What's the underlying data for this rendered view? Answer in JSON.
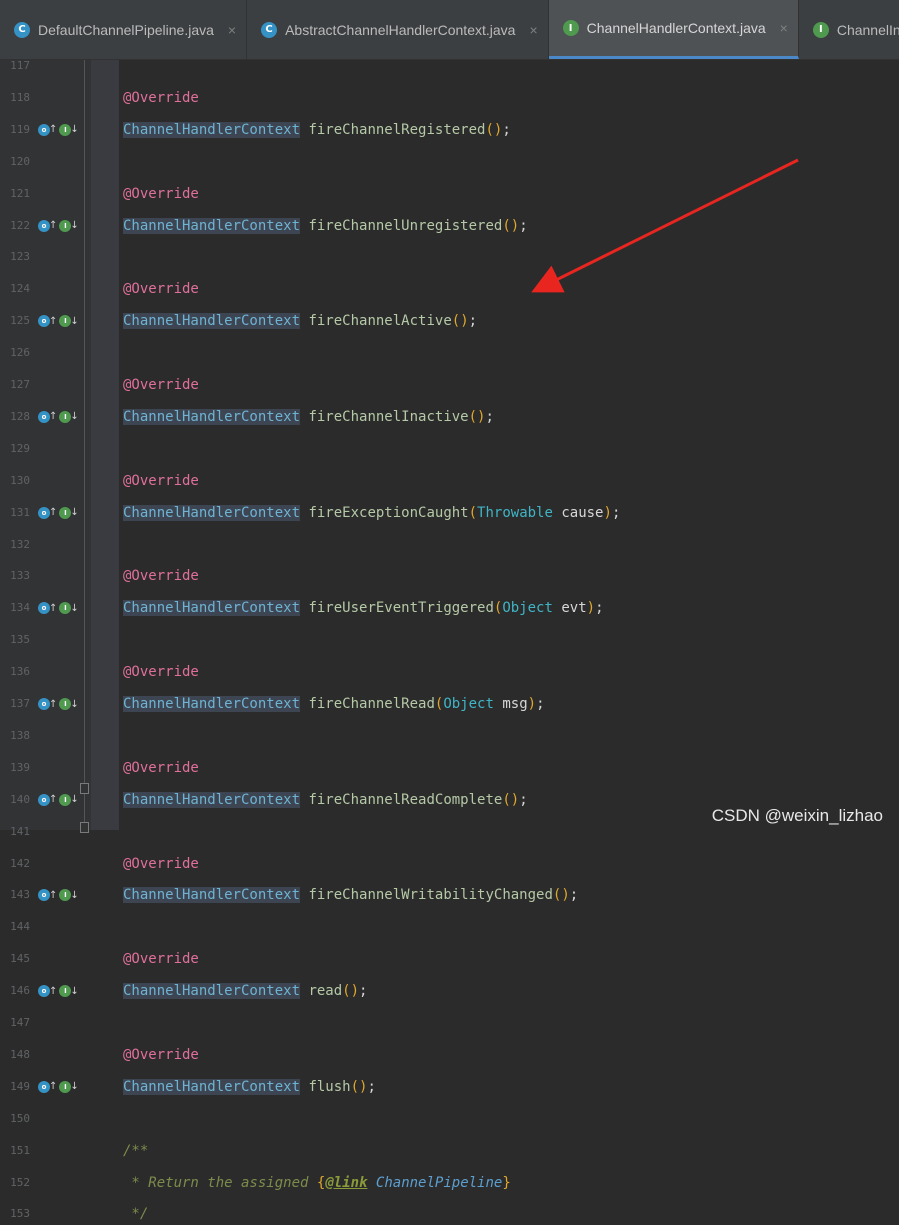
{
  "tabs": [
    {
      "label": "DefaultChannelPipeline.java",
      "icon": "class-icon",
      "icon_letter": "C",
      "close": "×"
    },
    {
      "label": "AbstractChannelHandlerContext.java",
      "icon": "class-icon",
      "icon_letter": "C",
      "close": "×"
    },
    {
      "label": "ChannelHandlerContext.java",
      "icon": "interface-icon",
      "icon_letter": "I",
      "close": "×"
    },
    {
      "label": "ChannelInbound",
      "icon": "interface-icon",
      "icon_letter": "I",
      "close": ""
    }
  ],
  "active_tab": 2,
  "editor": {
    "lines": [
      {
        "num": "117",
        "kind": "blank"
      },
      {
        "num": "118",
        "kind": "ann",
        "text": "@Override"
      },
      {
        "num": "119",
        "kind": "decl",
        "type": "ChannelHandlerContext",
        "method": "fireChannelRegistered",
        "args": "",
        "marks": true
      },
      {
        "num": "120",
        "kind": "blank"
      },
      {
        "num": "121",
        "kind": "ann",
        "text": "@Override"
      },
      {
        "num": "122",
        "kind": "decl",
        "type": "ChannelHandlerContext",
        "method": "fireChannelUnregistered",
        "args": "",
        "marks": true
      },
      {
        "num": "123",
        "kind": "blank"
      },
      {
        "num": "124",
        "kind": "ann",
        "text": "@Override"
      },
      {
        "num": "125",
        "kind": "decl",
        "type": "ChannelHandlerContext",
        "method": "fireChannelActive",
        "args": "",
        "marks": true
      },
      {
        "num": "126",
        "kind": "blank"
      },
      {
        "num": "127",
        "kind": "ann",
        "text": "@Override"
      },
      {
        "num": "128",
        "kind": "decl",
        "type": "ChannelHandlerContext",
        "method": "fireChannelInactive",
        "args": "",
        "marks": true
      },
      {
        "num": "129",
        "kind": "blank"
      },
      {
        "num": "130",
        "kind": "ann",
        "text": "@Override"
      },
      {
        "num": "131",
        "kind": "decl",
        "type": "ChannelHandlerContext",
        "method": "fireExceptionCaught",
        "argtype": "Throwable",
        "argname": "cause",
        "marks": true
      },
      {
        "num": "132",
        "kind": "blank"
      },
      {
        "num": "133",
        "kind": "ann",
        "text": "@Override"
      },
      {
        "num": "134",
        "kind": "decl",
        "type": "ChannelHandlerContext",
        "method": "fireUserEventTriggered",
        "argtype": "Object",
        "argname": "evt",
        "marks": true
      },
      {
        "num": "135",
        "kind": "blank"
      },
      {
        "num": "136",
        "kind": "ann",
        "text": "@Override"
      },
      {
        "num": "137",
        "kind": "decl",
        "type": "ChannelHandlerContext",
        "method": "fireChannelRead",
        "argtype": "Object",
        "argname": "msg",
        "marks": true
      },
      {
        "num": "138",
        "kind": "blank"
      },
      {
        "num": "139",
        "kind": "ann",
        "text": "@Override"
      },
      {
        "num": "140",
        "kind": "decl",
        "type": "ChannelHandlerContext",
        "method": "fireChannelReadComplete",
        "args": "",
        "marks": true
      },
      {
        "num": "141",
        "kind": "blank"
      },
      {
        "num": "142",
        "kind": "ann",
        "text": "@Override"
      },
      {
        "num": "143",
        "kind": "decl",
        "type": "ChannelHandlerContext",
        "method": "fireChannelWritabilityChanged",
        "args": "",
        "marks": true
      },
      {
        "num": "144",
        "kind": "blank"
      },
      {
        "num": "145",
        "kind": "ann",
        "text": "@Override"
      },
      {
        "num": "146",
        "kind": "decl",
        "type": "ChannelHandlerContext",
        "method": "read",
        "args": "",
        "marks": true
      },
      {
        "num": "147",
        "kind": "blank"
      },
      {
        "num": "148",
        "kind": "ann",
        "text": "@Override"
      },
      {
        "num": "149",
        "kind": "decl",
        "type": "ChannelHandlerContext",
        "method": "flush",
        "args": "",
        "marks": true
      },
      {
        "num": "150",
        "kind": "blank"
      },
      {
        "num": "151",
        "kind": "comment",
        "text": "/**"
      },
      {
        "num": "152",
        "kind": "doc",
        "pre": " * Return the assigned ",
        "open": "{",
        "tag": "@link",
        "ref": "ChannelPipeline",
        "close": "}"
      },
      {
        "num": "153",
        "kind": "comment",
        "text": " */"
      }
    ]
  },
  "watermark": "CSDN @weixin_lizhao",
  "colors": {
    "background": "#2b2b2b",
    "annotation": "#e0709b",
    "arrow": "#e8261f",
    "active_tab_underline": "#4a88c7"
  }
}
